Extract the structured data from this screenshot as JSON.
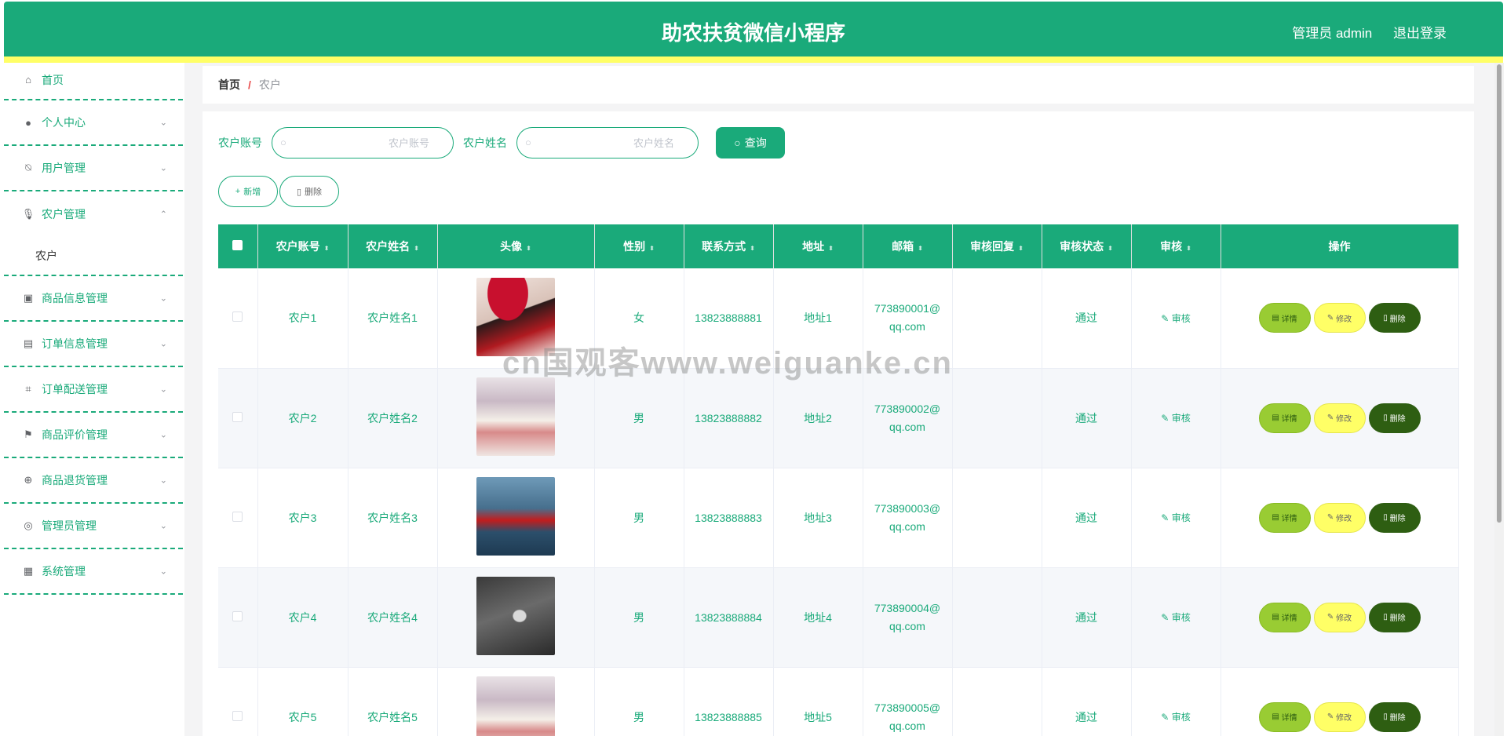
{
  "header": {
    "title": "助农扶贫微信小程序",
    "admin": "管理员 admin",
    "logout": "退出登录"
  },
  "sidebar": {
    "home": "首页",
    "items": [
      {
        "label": "个人中心"
      },
      {
        "label": "用户管理"
      },
      {
        "label": "农户管理"
      },
      {
        "label": "商品信息管理"
      },
      {
        "label": "订单信息管理"
      },
      {
        "label": "订单配送管理"
      },
      {
        "label": "商品评价管理"
      },
      {
        "label": "商品退货管理"
      },
      {
        "label": "管理员管理"
      },
      {
        "label": "系统管理"
      }
    ],
    "subitem": "农户"
  },
  "breadcrumb": {
    "home": "首页",
    "sep": "/",
    "current": "农户"
  },
  "search": {
    "label1": "农户账号",
    "placeholder1": "农户账号",
    "label2": "农户姓名",
    "placeholder2": "农户姓名",
    "query": "查询"
  },
  "actions": {
    "add": "新增",
    "delete": "删除"
  },
  "table": {
    "headers": [
      "农户账号",
      "农户姓名",
      "头像",
      "性别",
      "联系方式",
      "地址",
      "邮箱",
      "审核回复",
      "审核状态",
      "审核",
      "操作"
    ],
    "rows": [
      {
        "account": "农户1",
        "name": "农户姓名1",
        "gender": "女",
        "phone": "13823888881",
        "address": "地址1",
        "email1": "773890001@",
        "email2": "qq.com",
        "reply": "",
        "status": "通过",
        "audit": "审核"
      },
      {
        "account": "农户2",
        "name": "农户姓名2",
        "gender": "男",
        "phone": "13823888882",
        "address": "地址2",
        "email1": "773890002@",
        "email2": "qq.com",
        "reply": "",
        "status": "通过",
        "audit": "审核"
      },
      {
        "account": "农户3",
        "name": "农户姓名3",
        "gender": "男",
        "phone": "13823888883",
        "address": "地址3",
        "email1": "773890003@",
        "email2": "qq.com",
        "reply": "",
        "status": "通过",
        "audit": "审核"
      },
      {
        "account": "农户4",
        "name": "农户姓名4",
        "gender": "男",
        "phone": "13823888884",
        "address": "地址4",
        "email1": "773890004@",
        "email2": "qq.com",
        "reply": "",
        "status": "通过",
        "audit": "审核"
      },
      {
        "account": "农户5",
        "name": "农户姓名5",
        "gender": "男",
        "phone": "13823888885",
        "address": "地址5",
        "email1": "773890005@",
        "email2": "qq.com",
        "reply": "",
        "status": "通过",
        "audit": "审核"
      }
    ],
    "ops": {
      "detail": "详情",
      "edit": "修改",
      "delete": "删除"
    }
  },
  "watermark": "cn国观客www.weiguanke.cn",
  "colors": {
    "primary": "#1aaa7a",
    "accent": "#ffff66",
    "detail_btn": "#99cc33",
    "delete_btn": "#2e5e12"
  }
}
